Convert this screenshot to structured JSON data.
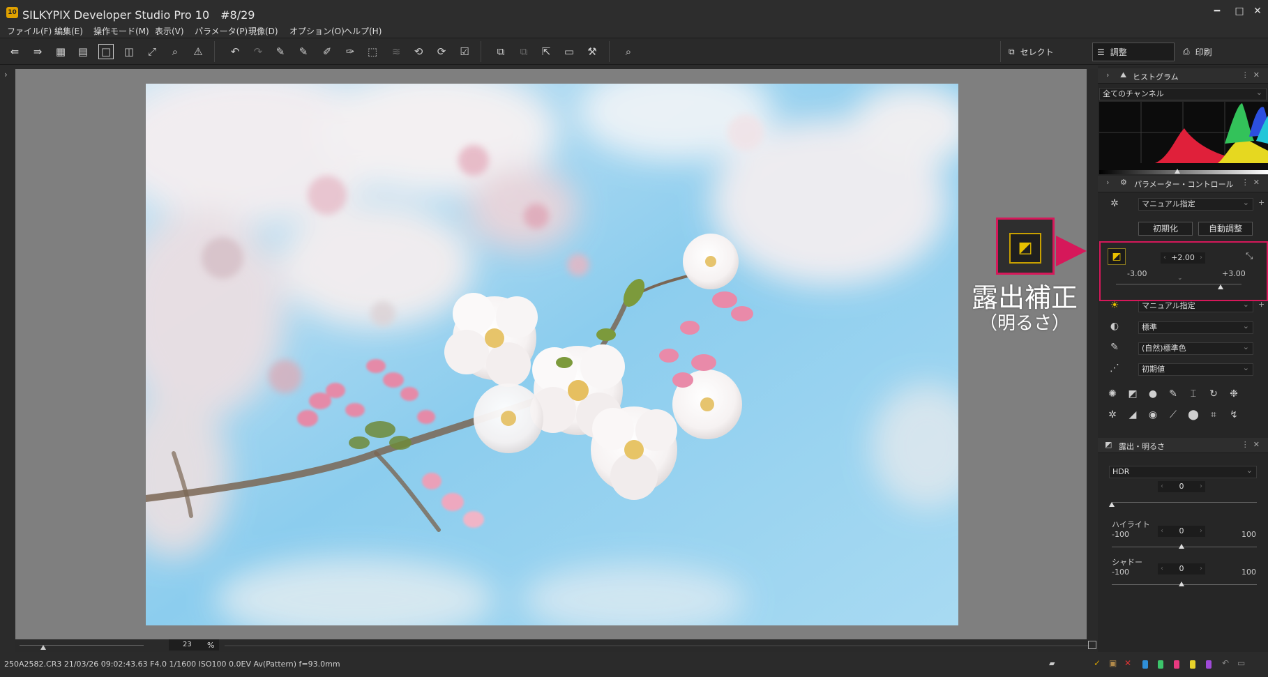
{
  "window": {
    "app_icon_text": "10",
    "title": "SILKYPIX Developer Studio Pro 10　#8/29",
    "minimize": "━",
    "maximize": "□",
    "close": "✕"
  },
  "menu": [
    "ファイル(F)",
    "編集(E)",
    "操作モード(M)",
    "表示(V)",
    "パラメータ(P)",
    "現像(D)",
    "オプション(O)",
    "ヘルプ(H)"
  ],
  "modes": {
    "select": "セレクト",
    "adjust": "調整",
    "print": "印刷"
  },
  "viewer": {
    "zoom_value": "23",
    "zoom_unit": "%"
  },
  "status": {
    "info": "250A2582.CR3 21/03/26 09:02:43.63 F4.0 1/1600 ISO100  0.0EV Av(Pattern) f=93.0mm"
  },
  "histogram": {
    "title": "ヒストグラム",
    "channel": "全てのチャンネル"
  },
  "param_control": {
    "title": "パラメーター・コントロール",
    "preset": "マニュアル指定",
    "init_button": "初期化",
    "auto_button": "自動調整",
    "exposure": {
      "value": "+2.00",
      "min": "-3.00",
      "max": "+3.00",
      "level": 0.833
    },
    "white_balance": "マニュアル指定",
    "tone": "標準",
    "color": "(自然)標準色",
    "sharpness": "初期値"
  },
  "exposure_panel": {
    "title": "露出・明るさ",
    "hdr_label": "HDR",
    "hdr_value": "0",
    "highlight_label": "ハイライト",
    "highlight_min": "-100",
    "highlight_max": "100",
    "highlight_value": "0",
    "shadow_label": "シャドー",
    "shadow_min": "-100",
    "shadow_max": "100",
    "shadow_value": "0"
  },
  "annotation": {
    "label": "露出補正",
    "sub": "（明るさ）",
    "color": "#d6185a"
  },
  "colors": {
    "accent": "#d6185a",
    "exposure_icon": "#e8c000"
  }
}
